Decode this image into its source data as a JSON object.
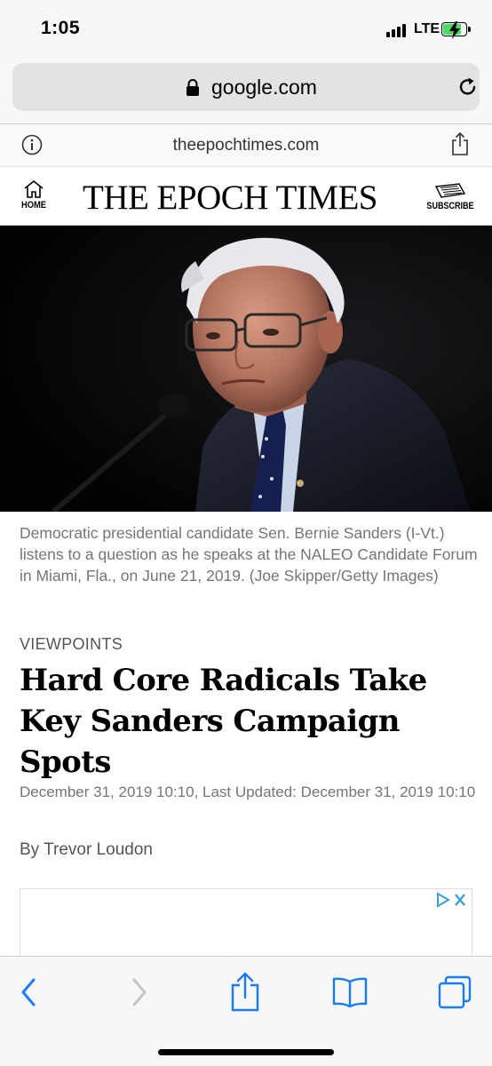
{
  "status_bar": {
    "time": "1:05",
    "network": "LTE",
    "battery_color": "#4cd964"
  },
  "browser": {
    "url_host": "google.com",
    "site_domain": "theepochtimes.com",
    "accent_color": "#1a7cf4"
  },
  "site_header": {
    "home_label": "HOME",
    "masthead": "THE EPOCH TIMES",
    "subscribe_label": "SUBSCRIBE"
  },
  "article": {
    "image_caption": "Democratic presidential candidate Sen. Bernie Sanders (I-Vt.) listens to a question as he speaks at the NALEO Candidate Forum in Miami, Fla., on June 21, 2019. (Joe Skipper/Getty Images)",
    "section": "VIEWPOINTS",
    "headline": "Hard Core Radicals Take Key Sanders Campaign Spots",
    "dateline": "December 31, 2019 10:10, Last Updated: December 31, 2019 10:10",
    "byline": "By Trevor Loudon"
  },
  "toolbar": {
    "icons": [
      "back-icon",
      "forward-icon",
      "share-icon",
      "bookmarks-icon",
      "tabs-icon"
    ]
  }
}
